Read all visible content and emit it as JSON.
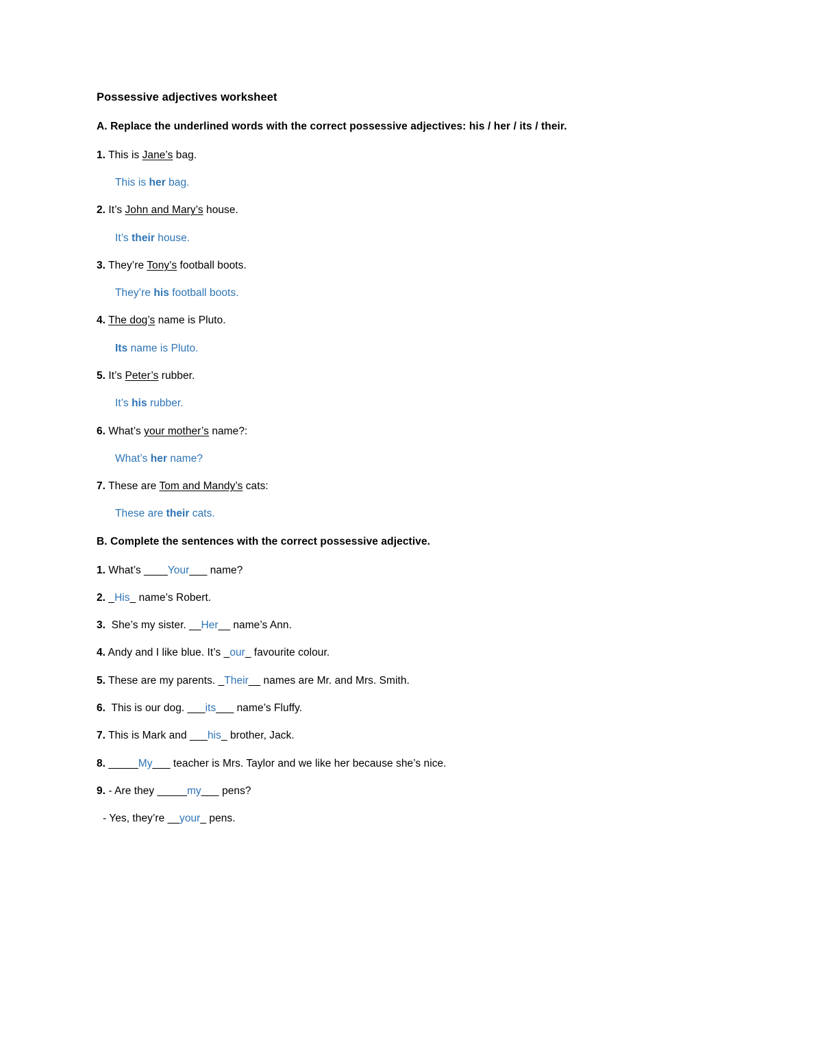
{
  "document": {
    "title": "Possessive adjectives worksheet",
    "answer_color": "#2E74B5",
    "text_color": "#000000",
    "background": "#ffffff"
  },
  "section_a": {
    "heading": "A. Replace the underlined words with the correct possessive adjectives: his / her / its / their.",
    "items": [
      {
        "number": "1.",
        "q_before": "This is ",
        "q_underlined": "Jane’s",
        "q_after": " bag.",
        "a_before": "This is ",
        "a_key": "her",
        "a_after": " bag."
      },
      {
        "number": "2.",
        "q_before": "It’s ",
        "q_underlined": "John and Mary’s",
        "q_after": " house.",
        "a_before": "It’s ",
        "a_key": "their",
        "a_after": " house."
      },
      {
        "number": "3.",
        "q_before": "They’re ",
        "q_underlined": "Tony’s",
        "q_after": " football boots.",
        "a_before": "They’re ",
        "a_key": "his",
        "a_after": " football boots."
      },
      {
        "number": "4.",
        "q_before": "",
        "q_underlined": "The dog’s",
        "q_after": " name is Pluto.",
        "a_before": "",
        "a_key": "Its",
        "a_after": " name is Pluto."
      },
      {
        "number": "5.",
        "q_before": "It’s ",
        "q_underlined": "Peter’s",
        "q_after": " rubber.",
        "a_before": "It’s ",
        "a_key": "his",
        "a_after": " rubber."
      },
      {
        "number": "6.",
        "q_before": "What’s ",
        "q_underlined": "your mother’s",
        "q_after": " name?:",
        "a_before": "What’s ",
        "a_key": "her",
        "a_after": " name?"
      },
      {
        "number": "7.",
        "q_before": "These are ",
        "q_underlined": "Tom and Mandy’s",
        "q_after": " cats:",
        "a_before": "These are ",
        "a_key": "their",
        "a_after": " cats."
      }
    ]
  },
  "section_b": {
    "heading": "B. Complete the sentences with the correct possessive adjective.",
    "items": [
      {
        "number": "1.",
        "num_space": " ",
        "before": "What’s ",
        "rule_left": "____",
        "answer": "Your",
        "rule_right": "___",
        "after": " name?"
      },
      {
        "number": "2.",
        "num_space": " ",
        "before": "",
        "rule_left": "_",
        "answer": "His",
        "rule_right": "_",
        "after": " name’s Robert."
      },
      {
        "number": "3.",
        "num_space": "  ",
        "before": "She’s my sister. ",
        "rule_left": "__",
        "answer": "Her",
        "rule_right": "__",
        "after": " name’s Ann."
      },
      {
        "number": "4.",
        "num_space": " ",
        "before": "Andy and I like blue. It’s ",
        "rule_left": "_",
        "answer": "our",
        "rule_right": "_",
        "after": " favourite colour."
      },
      {
        "number": "5.",
        "num_space": " ",
        "before": "These are my parents. ",
        "rule_left": "_",
        "answer": "Their",
        "rule_right": "__",
        "after": " names are Mr. and Mrs. Smith."
      },
      {
        "number": "6.",
        "num_space": "  ",
        "before": "This is our dog. ",
        "rule_left": "___",
        "answer": "its",
        "rule_right": "___",
        "after": " name’s Fluffy."
      },
      {
        "number": "7.",
        "num_space": " ",
        "before": "This is Mark and ",
        "rule_left": "___",
        "answer": "his",
        "rule_right": "_",
        "after": " brother, Jack."
      },
      {
        "number": "8.",
        "num_space": " ",
        "before": "",
        "rule_left": "_____",
        "answer": "My",
        "rule_right": "___",
        "after": " teacher is Mrs. Taylor and we like her because she’s nice."
      },
      {
        "number": "9.",
        "num_space": " ",
        "before": "- Are they ",
        "rule_left": "_____",
        "answer": "my",
        "rule_right": "___",
        "after": " pens?"
      }
    ],
    "final_line": {
      "before": "- Yes, they’re ",
      "rule_left": "__",
      "answer": "your",
      "rule_right": "_",
      "after": " pens."
    }
  }
}
